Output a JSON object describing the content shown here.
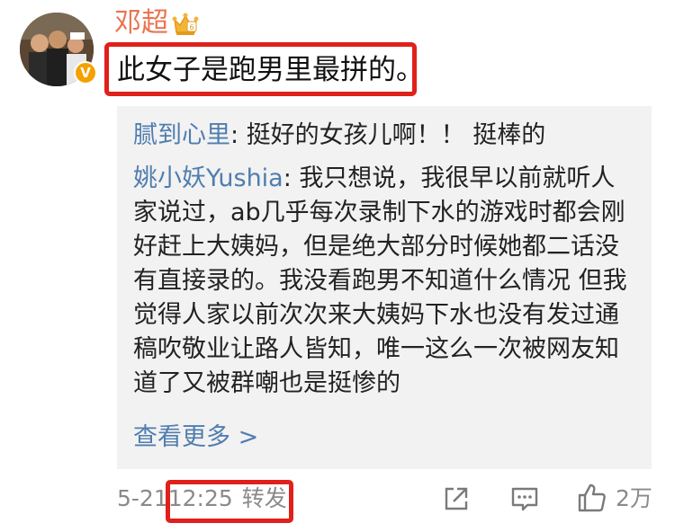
{
  "comment": {
    "author": "邓超",
    "text": "此女子是跑男里最拼的。",
    "avatar_icon": "avatar-photo",
    "verified_icon": "verified-v-icon",
    "verified_label": "V",
    "badge_icon": "crown-badge-icon"
  },
  "replies": [
    {
      "name": "腻到心里",
      "separator": ": ",
      "text": "挺好的女孩儿啊！！ 挺棒的"
    },
    {
      "name": "姚小妖Yushia",
      "separator": ": ",
      "text": "我只想说，我很早以前就听人家说过，ab几乎每次录制下水的游戏时都会刚好赶上大姨妈，但是绝大部分时候她都二话没有直接录的。我没看跑男不知道什么情况 但我觉得人家以前次次来大姨妈下水也没有发过通稿吹敬业让路人皆知，唯一这么一次被网友知道了又被群嘲也是挺惨的"
    }
  ],
  "more_link": "查看更多 >",
  "footer": {
    "date": "5-21",
    "time": "12:25",
    "repost": "转发",
    "like_count": "2万"
  },
  "colors": {
    "username": "#eb7350",
    "link": "#507daf",
    "highlight": "#e0201b",
    "panel_bg": "#f2f2f2",
    "meta_text": "#8a8a8a"
  }
}
